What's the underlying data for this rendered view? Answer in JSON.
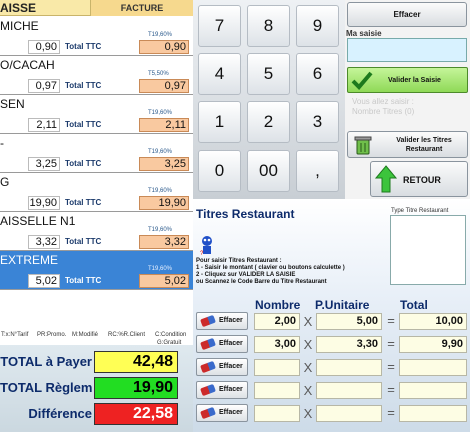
{
  "left_panel": {
    "header_left": "AISSE",
    "header_right": "FACTURE",
    "total_ttc_label": "Total TTC",
    "items": [
      {
        "name": "MICHE",
        "qty": "0,90",
        "tva": "T19,60%",
        "price": "0,90",
        "selected": false
      },
      {
        "name": "O/CACAH",
        "qty": "0,97",
        "tva": "T5,50%",
        "price": "0,97",
        "selected": false
      },
      {
        "name": "SEN",
        "qty": "2,11",
        "tva": "T19,60%",
        "price": "2,11",
        "selected": false
      },
      {
        "name": "-",
        "qty": "3,25",
        "tva": "T19,60%",
        "price": "3,25",
        "selected": false
      },
      {
        "name": "G",
        "qty": "19,90",
        "tva": "T19,60%",
        "price": "19,90",
        "selected": false
      },
      {
        "name": "AISSELLE N1",
        "qty": "3,32",
        "tva": "T19,60%",
        "price": "3,32",
        "selected": false
      },
      {
        "name": "EXTREME",
        "qty": "5,02",
        "tva": "T19,60%",
        "price": "5,02",
        "selected": true
      }
    ],
    "legend": [
      "T:x:N°Tarif",
      "PR:Promo.",
      "M:Modifié",
      "RC:%R.Client",
      "C:Condition",
      "G:Gratuit"
    ],
    "totals": {
      "a_payer_label": "TOTAL à Payer",
      "a_payer": "42,48",
      "a_payer_color": "#ffff55",
      "reglement_label": "TOTAL Règleme",
      "reglement": "19,90",
      "reglement_color": "#22dd22",
      "difference_label": "Différence",
      "difference": "22,58",
      "difference_color": "#ee2222"
    }
  },
  "keypad": [
    "7",
    "8",
    "9",
    "4",
    "5",
    "6",
    "1",
    "2",
    "3",
    "0",
    "00",
    ","
  ],
  "right_panel": {
    "effacer_label": "Effacer",
    "ma_saisie_label": "Ma saisie",
    "ma_saisie_value": "",
    "valider_saisie_label": "Valider la Saisie",
    "ghost_lines": [
      "Vous allez saisir :",
      "Nombre Titres (0)"
    ],
    "valider_titres_label_1": "Valider les Titres",
    "valider_titres_label_2": "Restaurant",
    "retour_label": "RETOUR"
  },
  "titres": {
    "title": "Titres Restaurant",
    "type_label": "Type Titre Restaurant",
    "instructions": [
      "Pour saisir Titres Restaurant :",
      "1 - Saisir le montant ( clavier ou boutons calculette )",
      "2 - Cliquez sur VALIDER LA SAISIE",
      "ou Scannez le Code Barre du Titre Restaurant"
    ],
    "col_nombre": "Nombre",
    "col_unitaire": "P.Unitaire",
    "col_total": "Total",
    "rows": [
      {
        "nombre": "2,00",
        "unitaire": "5,00",
        "total": "10,00"
      },
      {
        "nombre": "3,00",
        "unitaire": "3,30",
        "total": "9,90"
      },
      {
        "nombre": "",
        "unitaire": "",
        "total": ""
      },
      {
        "nombre": "",
        "unitaire": "",
        "total": ""
      },
      {
        "nombre": "",
        "unitaire": "",
        "total": ""
      }
    ],
    "effacer_label": "Effacer",
    "times": "X",
    "equals": "="
  }
}
